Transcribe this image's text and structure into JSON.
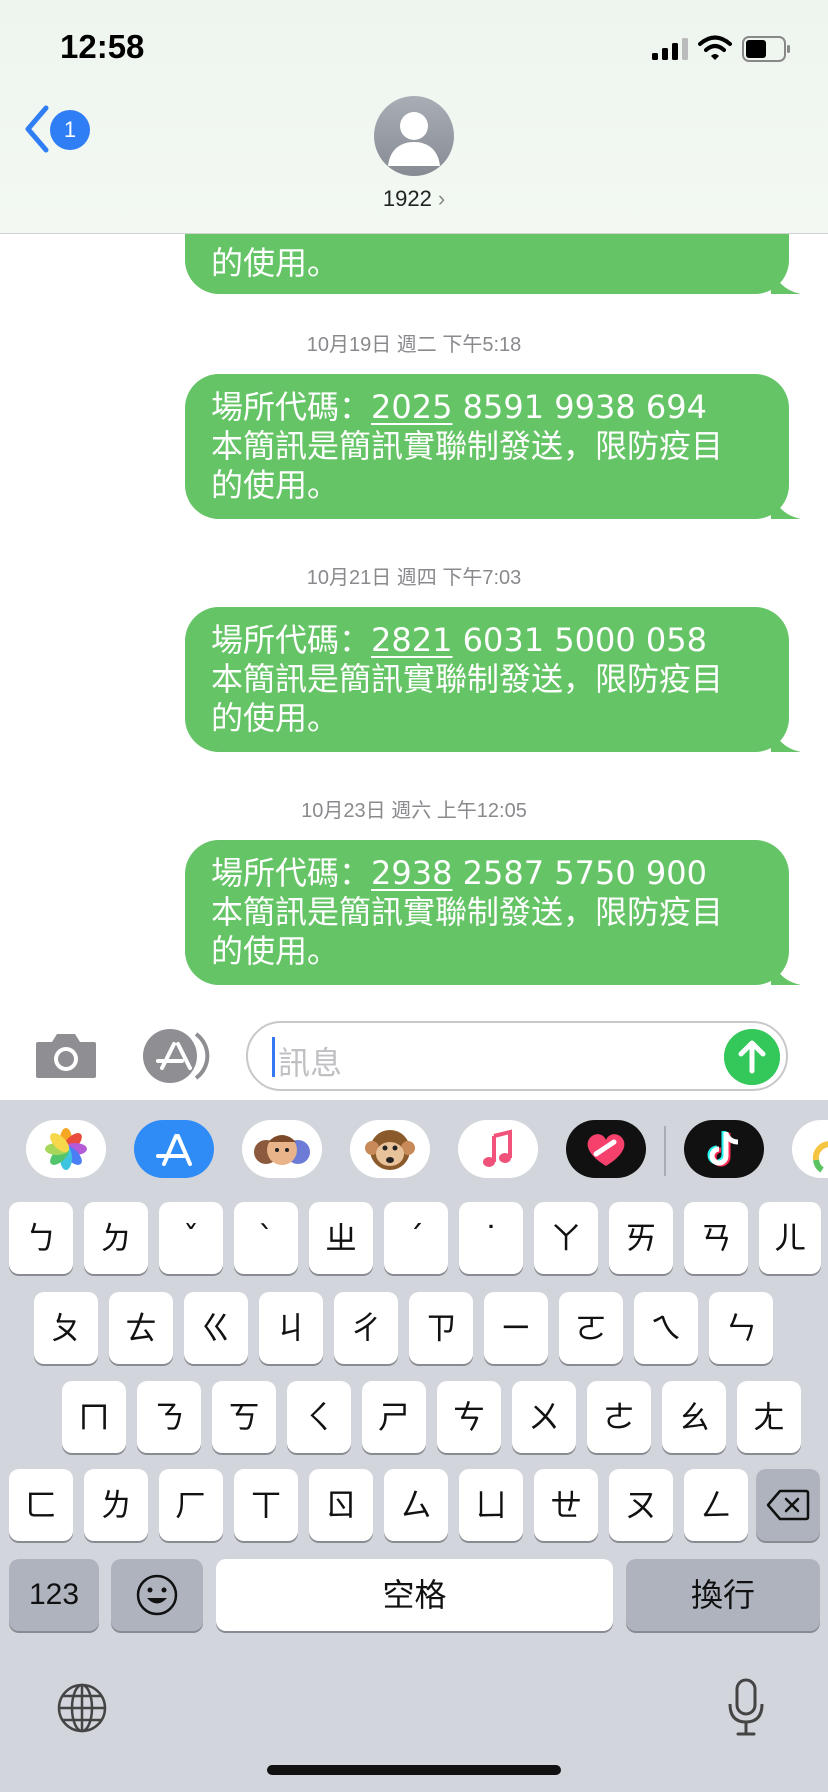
{
  "status_bar": {
    "time": "12:58"
  },
  "header": {
    "back_badge": "1",
    "contact_name": "1922",
    "contact_chevron": "›"
  },
  "messages": [
    {
      "timestamp": "",
      "line1_prefix": "",
      "line1_code": "",
      "line1_rest": "",
      "line2": "",
      "line3": "的使用。"
    },
    {
      "timestamp": "10月19日 週二 下午5:18",
      "line1_prefix": "場所代碼：",
      "line1_code": "2025",
      "line1_rest": " 8591 9938 694",
      "line2": "本簡訊是簡訊實聯制發送，限防疫目",
      "line3": "的使用。"
    },
    {
      "timestamp": "10月21日 週四 下午7:03",
      "line1_prefix": "場所代碼：",
      "line1_code": "2821",
      "line1_rest": " 6031 5000 058",
      "line2": "本簡訊是簡訊實聯制發送，限防疫目",
      "line3": "的使用。"
    },
    {
      "timestamp": "10月23日 週六 上午12:05",
      "line1_prefix": "場所代碼：",
      "line1_code": "2938",
      "line1_rest": " 2587 5750 900",
      "line2": "本簡訊是簡訊實聯制發送，限防疫目",
      "line3": "的使用。"
    }
  ],
  "input_bar": {
    "placeholder": "訊息",
    "icons": [
      "camera-icon",
      "app-store-icon",
      "send-arrow-icon"
    ]
  },
  "app_strip": [
    "photos-app-icon",
    "app-store-app-icon",
    "memoji-app-icon",
    "animoji-app-icon",
    "music-app-icon",
    "heart-app-icon",
    "tiktok-app-icon",
    "partial-app-icon"
  ],
  "keyboard": {
    "row1": [
      "ㄅ",
      "ㄉ",
      "ˇ",
      "ˋ",
      "ㄓ",
      "ˊ",
      "˙",
      "ㄚ",
      "ㄞ",
      "ㄢ",
      "ㄦ"
    ],
    "row2": [
      "ㄆ",
      "ㄊ",
      "ㄍ",
      "ㄐ",
      "ㄔ",
      "ㄗ",
      "ㄧ",
      "ㄛ",
      "ㄟ",
      "ㄣ"
    ],
    "row3": [
      "ㄇ",
      "ㄋ",
      "ㄎ",
      "ㄑ",
      "ㄕ",
      "ㄘ",
      "ㄨ",
      "ㄜ",
      "ㄠ",
      "ㄤ"
    ],
    "row4": [
      "ㄈ",
      "ㄌ",
      "ㄏ",
      "ㄒ",
      "ㄖ",
      "ㄙ",
      "ㄩ",
      "ㄝ",
      "ㄡ",
      "ㄥ"
    ],
    "numbers_key": "123",
    "space_key": "空格",
    "return_key": "換行"
  },
  "colors": {
    "bubble": "#65c466",
    "badge": "#2f7ef5",
    "send": "#34c759"
  }
}
